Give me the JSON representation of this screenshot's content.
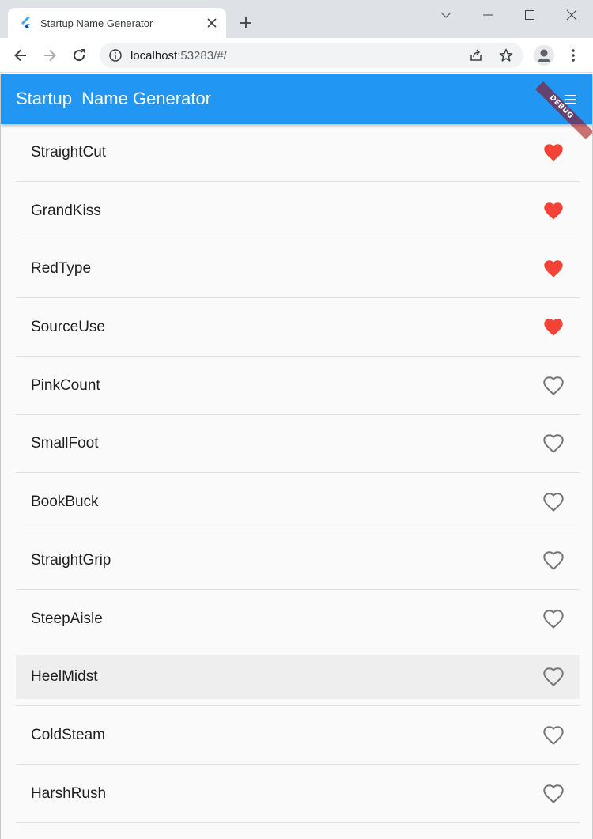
{
  "browser": {
    "tab_title": "Startup Name Generator",
    "url_host": "localhost",
    "url_rest": ":53283/#/"
  },
  "app": {
    "title": "Startup  Name Generator",
    "debug_label": "DEBUG",
    "accent_color": "#2196f3",
    "heart_color": "#f44336"
  },
  "items": [
    {
      "name": "StraightCut",
      "saved": true
    },
    {
      "name": "GrandKiss",
      "saved": true
    },
    {
      "name": "RedType",
      "saved": true
    },
    {
      "name": "SourceUse",
      "saved": true
    },
    {
      "name": "PinkCount",
      "saved": false
    },
    {
      "name": "SmallFoot",
      "saved": false
    },
    {
      "name": "BookBuck",
      "saved": false
    },
    {
      "name": "StraightGrip",
      "saved": false
    },
    {
      "name": "SteepAisle",
      "saved": false
    },
    {
      "name": "HeelMidst",
      "saved": false
    },
    {
      "name": "ColdSteam",
      "saved": false
    },
    {
      "name": "HarshRush",
      "saved": false
    }
  ]
}
